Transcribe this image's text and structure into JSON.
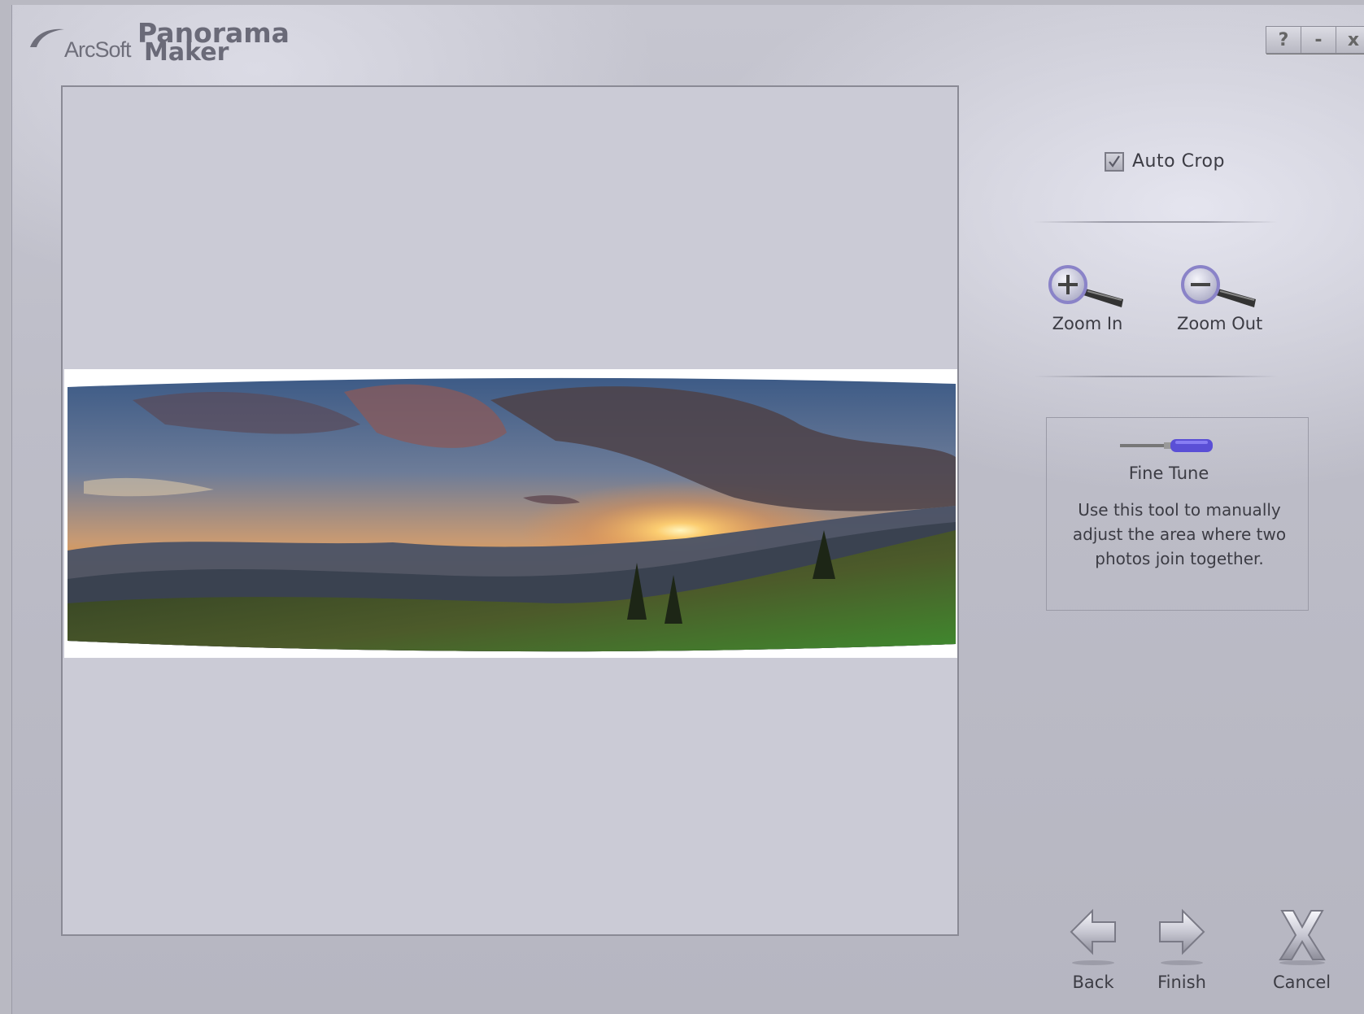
{
  "app": {
    "brand": "ArcSoft",
    "product_line1": "Panorama",
    "product_line2": "Maker"
  },
  "window_controls": {
    "help": "?",
    "minimize": "-",
    "close": "x"
  },
  "options": {
    "auto_crop_label": "Auto Crop",
    "auto_crop_checked": true
  },
  "zoom": {
    "zoom_in_label": "Zoom In",
    "zoom_out_label": "Zoom Out"
  },
  "fine_tune": {
    "title": "Fine Tune",
    "description": "Use this tool to manually adjust the area where two photos join together."
  },
  "navigation": {
    "back_label": "Back",
    "finish_label": "Finish",
    "cancel_label": "Cancel"
  },
  "colors": {
    "background": "#bdbdc8",
    "canvas": "#cbcbd6",
    "text": "#3c3c44",
    "accent_purple": "#5a4fd6"
  }
}
